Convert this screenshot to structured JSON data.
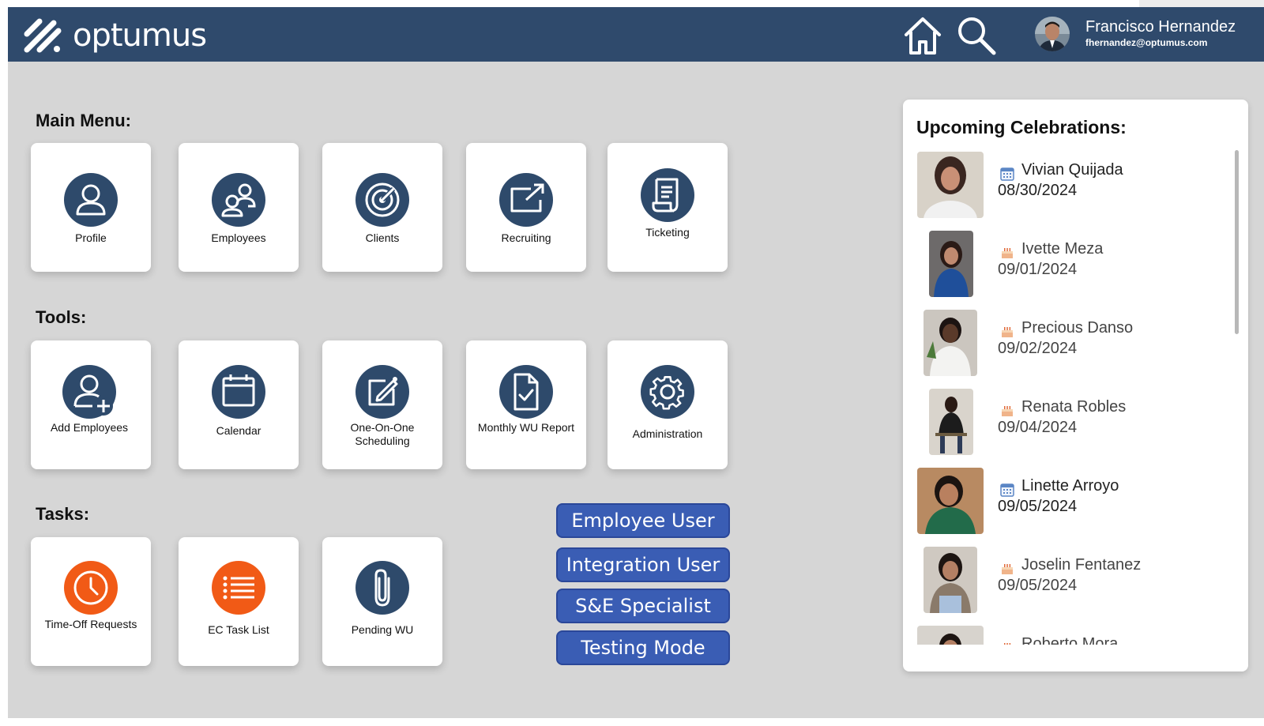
{
  "app": {
    "brand": "optumus"
  },
  "user": {
    "name": "Francisco Hernandez",
    "email": "fhernandez@optumus.com"
  },
  "sections": {
    "main_menu": "Main Menu:",
    "tools": "Tools:",
    "tasks": "Tasks:"
  },
  "main_menu": [
    {
      "label": "Profile",
      "icon": "person-icon"
    },
    {
      "label": "Employees",
      "icon": "people-icon"
    },
    {
      "label": "Clients",
      "icon": "target-icon"
    },
    {
      "label": "Recruiting",
      "icon": "share-icon"
    },
    {
      "label": "Ticketing",
      "icon": "receipt-icon"
    }
  ],
  "tools": [
    {
      "label": "Add Employees",
      "icon": "add-person-icon"
    },
    {
      "label": "Calendar",
      "icon": "calendar-icon"
    },
    {
      "label": "One-On-One Scheduling",
      "icon": "edit-note-icon"
    },
    {
      "label": "Monthly WU Report",
      "icon": "document-check-icon"
    },
    {
      "label": "Administration",
      "icon": "gear-icon"
    }
  ],
  "tasks": [
    {
      "label": "Time-Off Requests",
      "icon": "clock-icon"
    },
    {
      "label": "EC Task List",
      "icon": "list-icon"
    },
    {
      "label": "Pending WU",
      "icon": "paperclip-icon"
    }
  ],
  "roles": [
    "Employee User",
    "Integration User",
    "S&E Specialist",
    "Testing Mode"
  ],
  "celebrations": {
    "title": "Upcoming Celebrations:",
    "items": [
      {
        "name": "Vivian Quijada",
        "date": "08/30/2024",
        "icon": "calendar-icon"
      },
      {
        "name": "Ivette Meza",
        "date": "09/01/2024",
        "icon": "cake-icon"
      },
      {
        "name": "Precious Danso",
        "date": "09/02/2024",
        "icon": "cake-icon"
      },
      {
        "name": "Renata Robles",
        "date": "09/04/2024",
        "icon": "cake-icon"
      },
      {
        "name": "Linette Arroyo",
        "date": "09/05/2024",
        "icon": "calendar-icon"
      },
      {
        "name": "Joselin Fentanez",
        "date": "09/05/2024",
        "icon": "cake-icon"
      },
      {
        "name": "Roberto Mora",
        "date": "",
        "icon": "cake-icon"
      }
    ]
  },
  "colors": {
    "header": "#2f4a6c",
    "icon_navy": "#2e4a6b",
    "icon_orange": "#f15a16",
    "role_button": "#3a5db4"
  }
}
